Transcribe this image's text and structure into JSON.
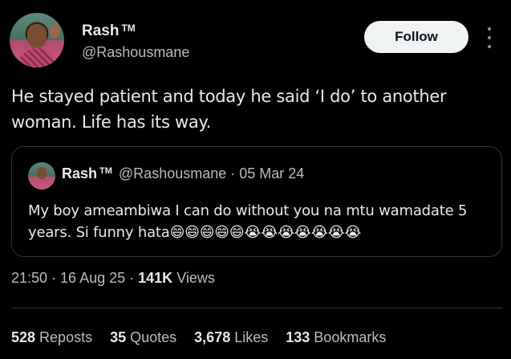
{
  "author": {
    "display_name": "Rash",
    "tm": "TM",
    "handle": "@Rashousmane"
  },
  "follow_label": "Follow",
  "tweet_text": "He stayed patient and today he said ‘I do’ to another woman. Life has its way.",
  "quoted_tweet": {
    "display_name": "Rash",
    "tm": "TM",
    "handle": "@Rashousmane",
    "separator": "·",
    "date": "05 Mar 24",
    "text": "My boy ameambiwa I can do without you na mtu wamadate 5 years. Si funny hata😄😄😄😄😄😭😭😭😭😭😭😭"
  },
  "meta": {
    "time": "21:50",
    "separator": "·",
    "date": "16 Aug 25",
    "views_count": "141K",
    "views_label": "Views"
  },
  "stats": [
    {
      "count": "528",
      "label": "Reposts"
    },
    {
      "count": "35",
      "label": "Quotes"
    },
    {
      "count": "3,678",
      "label": "Likes"
    },
    {
      "count": "133",
      "label": "Bookmarks"
    }
  ],
  "colors": {
    "background": "#000000",
    "text_primary": "#e7e9ea",
    "text_secondary": "#b8bcc0",
    "border": "#2f3336",
    "follow_button_bg": "#eff3f4"
  },
  "icons": {
    "more": "more-vertical-icon"
  }
}
